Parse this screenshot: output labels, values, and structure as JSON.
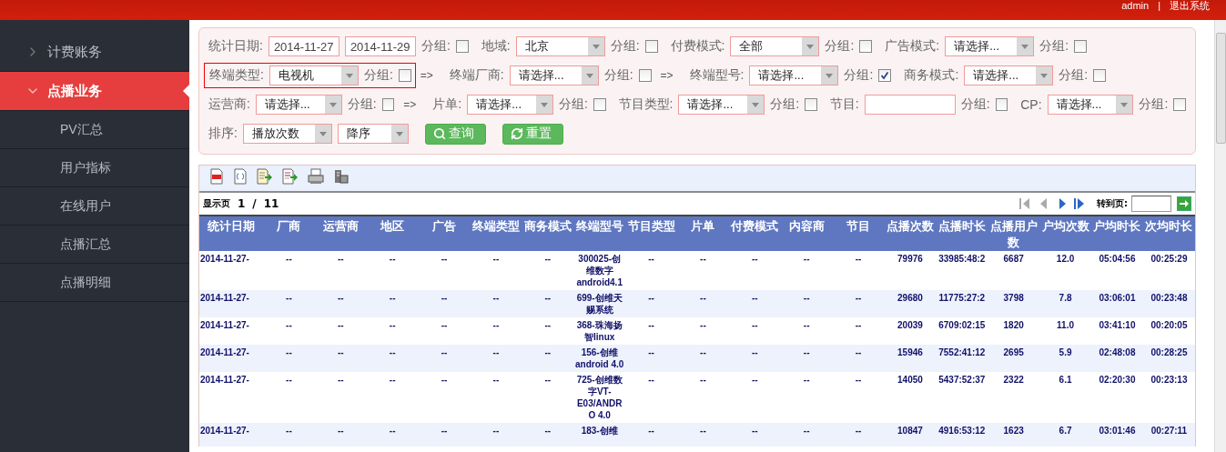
{
  "header": {
    "user": "admin",
    "separator": "|",
    "logout": "退出系统"
  },
  "sidebar": {
    "items": [
      {
        "label": "计费账务",
        "expanded": false,
        "selected": false
      },
      {
        "label": "点播业务",
        "expanded": true,
        "selected": true,
        "children": [
          {
            "label": "PV汇总"
          },
          {
            "label": "用户指标"
          },
          {
            "label": "在线用户"
          },
          {
            "label": "点播汇总"
          },
          {
            "label": "点播明细"
          }
        ]
      }
    ]
  },
  "filter": {
    "rows": [
      {
        "items": [
          {
            "kind": "label",
            "text": "统计日期:"
          },
          {
            "kind": "date",
            "value": "2014-11-27"
          },
          {
            "kind": "date",
            "value": "2014-11-29"
          },
          {
            "kind": "group",
            "text": "分组:",
            "checked": false
          },
          {
            "kind": "label",
            "text": "地域:"
          },
          {
            "kind": "select",
            "value": "北京"
          },
          {
            "kind": "group",
            "text": "分组:",
            "checked": false
          },
          {
            "kind": "label",
            "text": "付费模式:"
          },
          {
            "kind": "select",
            "value": "全部"
          },
          {
            "kind": "group",
            "text": "分组:",
            "checked": false
          },
          {
            "kind": "label",
            "text": "广告模式:"
          },
          {
            "kind": "select",
            "value": "请选择..."
          },
          {
            "kind": "group",
            "text": "分组:",
            "checked": false
          }
        ]
      },
      {
        "items": [
          {
            "kind": "highlight",
            "items": [
              {
                "kind": "label",
                "text": "终端类型:"
              },
              {
                "kind": "select",
                "value": "电视机"
              },
              {
                "kind": "group",
                "text": "分组:",
                "checked": false
              }
            ]
          },
          {
            "kind": "arrow",
            "text": "=>"
          },
          {
            "kind": "label",
            "text": "终端厂商:"
          },
          {
            "kind": "select",
            "value": "请选择..."
          },
          {
            "kind": "group",
            "text": "分组:",
            "checked": false
          },
          {
            "kind": "arrow",
            "text": "=>"
          },
          {
            "kind": "label",
            "text": "终端型号:"
          },
          {
            "kind": "select",
            "value": "请选择..."
          },
          {
            "kind": "group",
            "text": "分组:",
            "checked": true
          },
          {
            "kind": "label",
            "text": "商务模式:"
          },
          {
            "kind": "select",
            "value": "请选择..."
          },
          {
            "kind": "group",
            "text": "分组:",
            "checked": false
          }
        ]
      },
      {
        "items": [
          {
            "kind": "label",
            "text": "运营商:"
          },
          {
            "kind": "select",
            "value": "请选择..."
          },
          {
            "kind": "group",
            "text": "分组:",
            "checked": false
          },
          {
            "kind": "arrow",
            "text": "=>"
          },
          {
            "kind": "label",
            "text": "片单:"
          },
          {
            "kind": "select",
            "value": "请选择..."
          },
          {
            "kind": "group",
            "text": "分组:",
            "checked": false
          },
          {
            "kind": "label",
            "text": "节目类型:"
          },
          {
            "kind": "select",
            "value": "请选择..."
          },
          {
            "kind": "group",
            "text": "分组:",
            "checked": false
          },
          {
            "kind": "label",
            "text": "节目:"
          },
          {
            "kind": "text"
          },
          {
            "kind": "group",
            "text": "分组:",
            "checked": false
          },
          {
            "kind": "label",
            "text": "CP:"
          },
          {
            "kind": "select",
            "value": "请选择..."
          },
          {
            "kind": "group",
            "text": "分组:",
            "checked": false
          }
        ]
      },
      {
        "items": [
          {
            "kind": "label",
            "text": "排序:"
          },
          {
            "kind": "select",
            "value": "播放次数"
          },
          {
            "kind": "select",
            "value": "降序",
            "narrow": true
          },
          {
            "kind": "button",
            "text": "查询"
          },
          {
            "kind": "button",
            "text": "重置"
          }
        ]
      }
    ]
  },
  "results": {
    "toolbar": [
      {
        "kind": "toc"
      },
      {
        "kind": "pdf"
      },
      {
        "kind": "export"
      },
      {
        "kind": "export-color"
      },
      {
        "kind": "print"
      },
      {
        "kind": "tools"
      }
    ],
    "pager": {
      "label": "显示页",
      "current": "1",
      "slash": "/",
      "total": "11",
      "nav": [
        {
          "kind": "first",
          "disabled": true
        },
        {
          "kind": "prev",
          "disabled": true
        },
        {
          "kind": "next",
          "disabled": false
        },
        {
          "kind": "last",
          "disabled": false
        }
      ],
      "goto_label": "转到页:"
    },
    "table": {
      "columns": [
        "统计日期",
        "厂商",
        "运营商",
        "地区",
        "广告",
        "终端类型",
        "商务模式",
        "终端型号",
        "节目类型",
        "片单",
        "付费模式",
        "内容商",
        "节目",
        "点播次数",
        "点播时长",
        "点播用户数",
        "户均次数",
        "户均时长",
        "次均时长"
      ],
      "rows": [
        [
          "2014-11-27-",
          "--",
          "--",
          "--",
          "--",
          "--",
          "--",
          "300025-创维数字android4.1",
          "--",
          "--",
          "--",
          "--",
          "--",
          "79976",
          "33985:48:2",
          "6687",
          "12.0",
          "05:04:56",
          "00:25:29"
        ],
        [
          "2014-11-27-",
          "--",
          "--",
          "--",
          "--",
          "--",
          "--",
          "699-创维天赐系统",
          "--",
          "--",
          "--",
          "--",
          "--",
          "29680",
          "11775:27:2",
          "3798",
          "7.8",
          "03:06:01",
          "00:23:48"
        ],
        [
          "2014-11-27-",
          "--",
          "--",
          "--",
          "--",
          "--",
          "--",
          "368-珠海扬智linux",
          "--",
          "--",
          "--",
          "--",
          "--",
          "20039",
          "6709:02:15",
          "1820",
          "11.0",
          "03:41:10",
          "00:20:05"
        ],
        [
          "2014-11-27-",
          "--",
          "--",
          "--",
          "--",
          "--",
          "--",
          "156-创维 android 4.0",
          "--",
          "--",
          "--",
          "--",
          "--",
          "15946",
          "7552:41:12",
          "2695",
          "5.9",
          "02:48:08",
          "00:28:25"
        ],
        [
          "2014-11-27-",
          "--",
          "--",
          "--",
          "--",
          "--",
          "--",
          "725-创维数字VT-E03/ANDRO 4.0",
          "--",
          "--",
          "--",
          "--",
          "--",
          "14050",
          "5437:52:37",
          "2322",
          "6.1",
          "02:20:30",
          "00:23:13"
        ],
        [
          "2014-11-27-",
          "--",
          "--",
          "--",
          "--",
          "--",
          "--",
          "183-创维",
          "--",
          "--",
          "--",
          "--",
          "--",
          "10847",
          "4916:53:12",
          "1623",
          "6.7",
          "03:01:46",
          "00:27:11"
        ]
      ]
    }
  }
}
